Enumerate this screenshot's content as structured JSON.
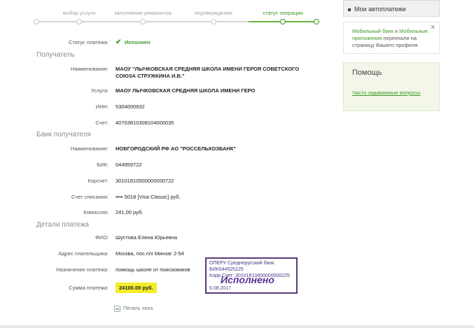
{
  "steps": [
    "выбор услуги",
    "заполнение реквизитов",
    "подтверждение",
    "статус операции"
  ],
  "status": {
    "label": "Статус платежа:",
    "value": "Исполнен"
  },
  "recipient": {
    "title": "Получатель",
    "name_label": "Наименование:",
    "name_value_1": "МАОУ \"ЛЫЧКОВСКАЯ СРЕДНЯЯ ШКОЛА ИМЕНИ ГЕРОЯ СОВЕТСКОГО",
    "name_value_2": "СОЮЗА СТРУЖКИНА И.В.\"",
    "service_label": "Услуга:",
    "service_value": "МАОУ ЛЫЧКОВСКАЯ СРЕДНЯЯ ШКОЛА ИМЕНИ ГЕРО",
    "inn_label": "ИНН:",
    "inn_value": "5304000932",
    "account_label": "Счет:",
    "account_value": "40703810308104000035"
  },
  "bank": {
    "title": "Банк получателя",
    "name_label": "Наименование:",
    "name_value": "НОВГОРОДСКИЙ РФ АО \"РОССЕЛЬХОЗБАНК\"",
    "bik_label": "БИК:",
    "bik_value": "044959722",
    "corr_label": "Корсчет:",
    "corr_value": "30101810500000000722",
    "debit_label": "Счет списания:",
    "debit_value": "•••• 5018  [Visa Classic]  руб.",
    "fee_label": "Комиссия:",
    "fee_value": "241,00 руб."
  },
  "details": {
    "title": "Детали платежа",
    "fio_label": "ФИО:",
    "fio_value": "Шустова Елена Юрьевна",
    "address_label": "Адрес плательщика:",
    "address_value": "Москва, пос.п/х Минзаг 2-54",
    "purpose_label": "Назначение платежа:",
    "purpose_value": "помощь школе от поисковиков",
    "amount_label": "Сумма платежа:",
    "amount_value": "24100.00 руб."
  },
  "print_label": "Печать чека",
  "stamp": {
    "line1": "ОПЕРУ Среднерусский банк",
    "line2": "БИК044525225",
    "line3": "Корр.Счет: 30101810400000000225",
    "big": "Исполнено",
    "date": "6.08.2017"
  },
  "sidebar": {
    "autopay": "Мои автоплатежи",
    "notice_link1": "Мобильный банк",
    "notice_and": " и ",
    "notice_link2": "Мобильные приложения",
    "notice_text": " переехали на страницу Вашего профиля",
    "help_title": "Помощь",
    "help_link": "Часто задаваемые вопросы"
  },
  "colors": {
    "accent": "#3f9a25",
    "amount_highlight": "#f4ec2a",
    "stamp": "#5a3a7a"
  }
}
